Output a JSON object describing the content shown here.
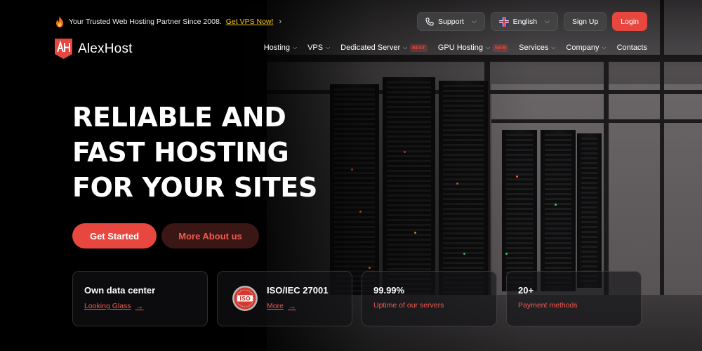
{
  "promo": {
    "text": "Your Trusted Web Hosting Partner Since 2008.",
    "link": "Get VPS Now!",
    "chevron": "›"
  },
  "utility": {
    "support": "Support",
    "language": "English",
    "signup": "Sign Up",
    "login": "Login",
    "dropdown_glyph": "⌵"
  },
  "brand": {
    "name": "AlexHost"
  },
  "nav": {
    "items": [
      {
        "label": "Hosting"
      },
      {
        "label": "VPS"
      },
      {
        "label": "Dedicated Server",
        "tag": "BEST"
      },
      {
        "label": "GPU Hosting",
        "tag": "NEW"
      },
      {
        "label": "Services"
      },
      {
        "label": "Company"
      },
      {
        "label": "Contacts"
      }
    ],
    "caret": "⌵"
  },
  "hero": {
    "lines": [
      "RELIABLE AND",
      "FAST HOSTING",
      "FOR YOUR SITES"
    ],
    "primary_cta": "Get Started",
    "secondary_cta": "More About us"
  },
  "cards": [
    {
      "title": "Own data center",
      "sub": "Looking Glass"
    },
    {
      "title": "ISO/IEC 27001",
      "sub": "More",
      "seal": "ISO"
    },
    {
      "title": "99.99%",
      "sub": "Uptime of our servers"
    },
    {
      "title": "20+",
      "sub": "Payment methods"
    }
  ],
  "arrow": "→",
  "colors": {
    "accent": "#e8473f",
    "promo_link": "#f5c518",
    "secondary_btn_bg": "#3a1614"
  }
}
